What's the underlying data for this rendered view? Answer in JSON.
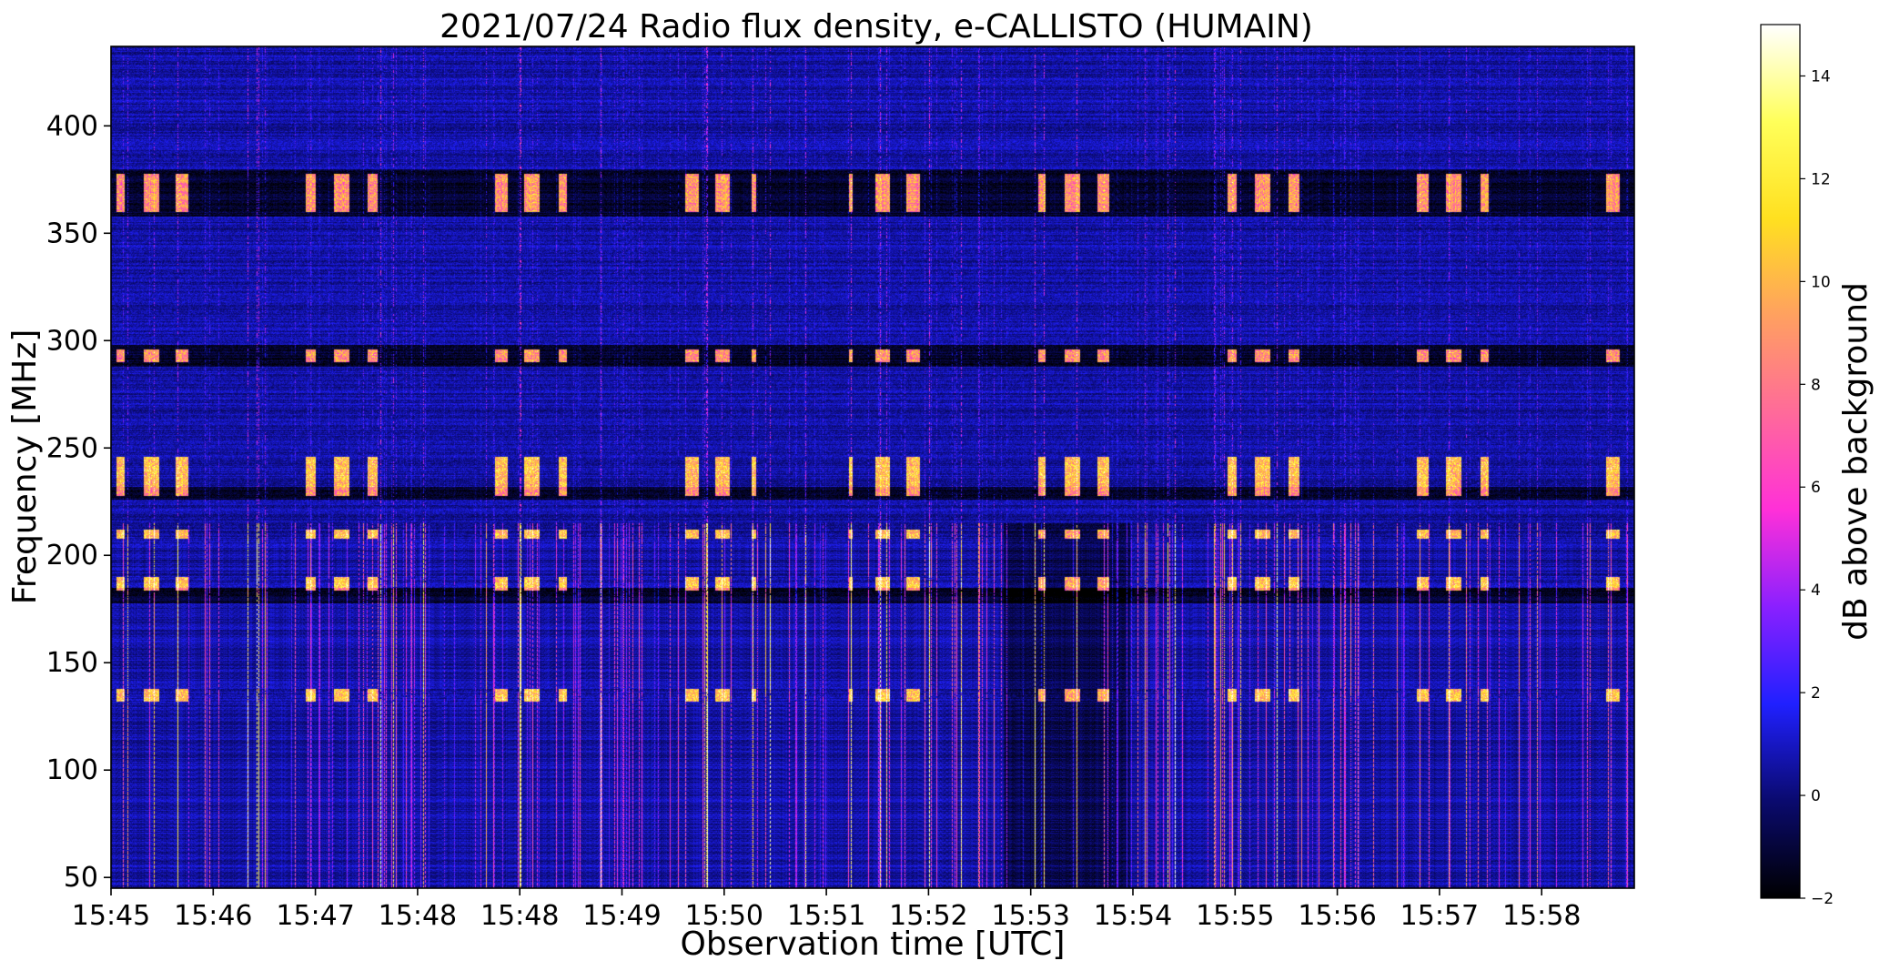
{
  "chart_data": {
    "type": "heatmap",
    "title": "2021/07/24  Radio flux density, e-CALLISTO (HUMAIN)",
    "xlabel": "Observation time [UTC]",
    "ylabel": "Frequency [MHz]",
    "x_ticks": [
      "15:45",
      "15:46",
      "15:47",
      "15:48",
      "15:48",
      "15:49",
      "15:50",
      "15:51",
      "15:52",
      "15:53",
      "15:54",
      "15:55",
      "15:56",
      "15:57",
      "15:58"
    ],
    "y_ticks": [
      50,
      100,
      150,
      200,
      250,
      300,
      350,
      400
    ],
    "ylim": [
      45,
      437
    ],
    "colorbar": {
      "label": "dB above background",
      "ticks": [
        -2,
        0,
        2,
        4,
        6,
        8,
        10,
        12,
        14
      ],
      "range": [
        -2,
        15
      ],
      "colormap": "gnuplot2",
      "stops": [
        "#000000",
        "#0a0a6e",
        "#2020ff",
        "#8a20ff",
        "#ff30d8",
        "#ff6a9a",
        "#ffa060",
        "#ffe020",
        "#ffff5a",
        "#ffffff"
      ]
    },
    "background_level_db": 0.6,
    "bright_bands_mhz": [
      [
        360,
        378
      ],
      [
        290,
        296
      ],
      [
        228,
        246
      ],
      [
        208,
        212
      ],
      [
        184,
        190
      ],
      [
        132,
        138
      ]
    ],
    "dark_bands_mhz": [
      [
        358,
        380
      ],
      [
        288,
        298
      ],
      [
        226,
        232
      ],
      [
        178,
        185
      ]
    ],
    "burst_region_mhz": [
      45,
      215
    ],
    "grid": false
  }
}
